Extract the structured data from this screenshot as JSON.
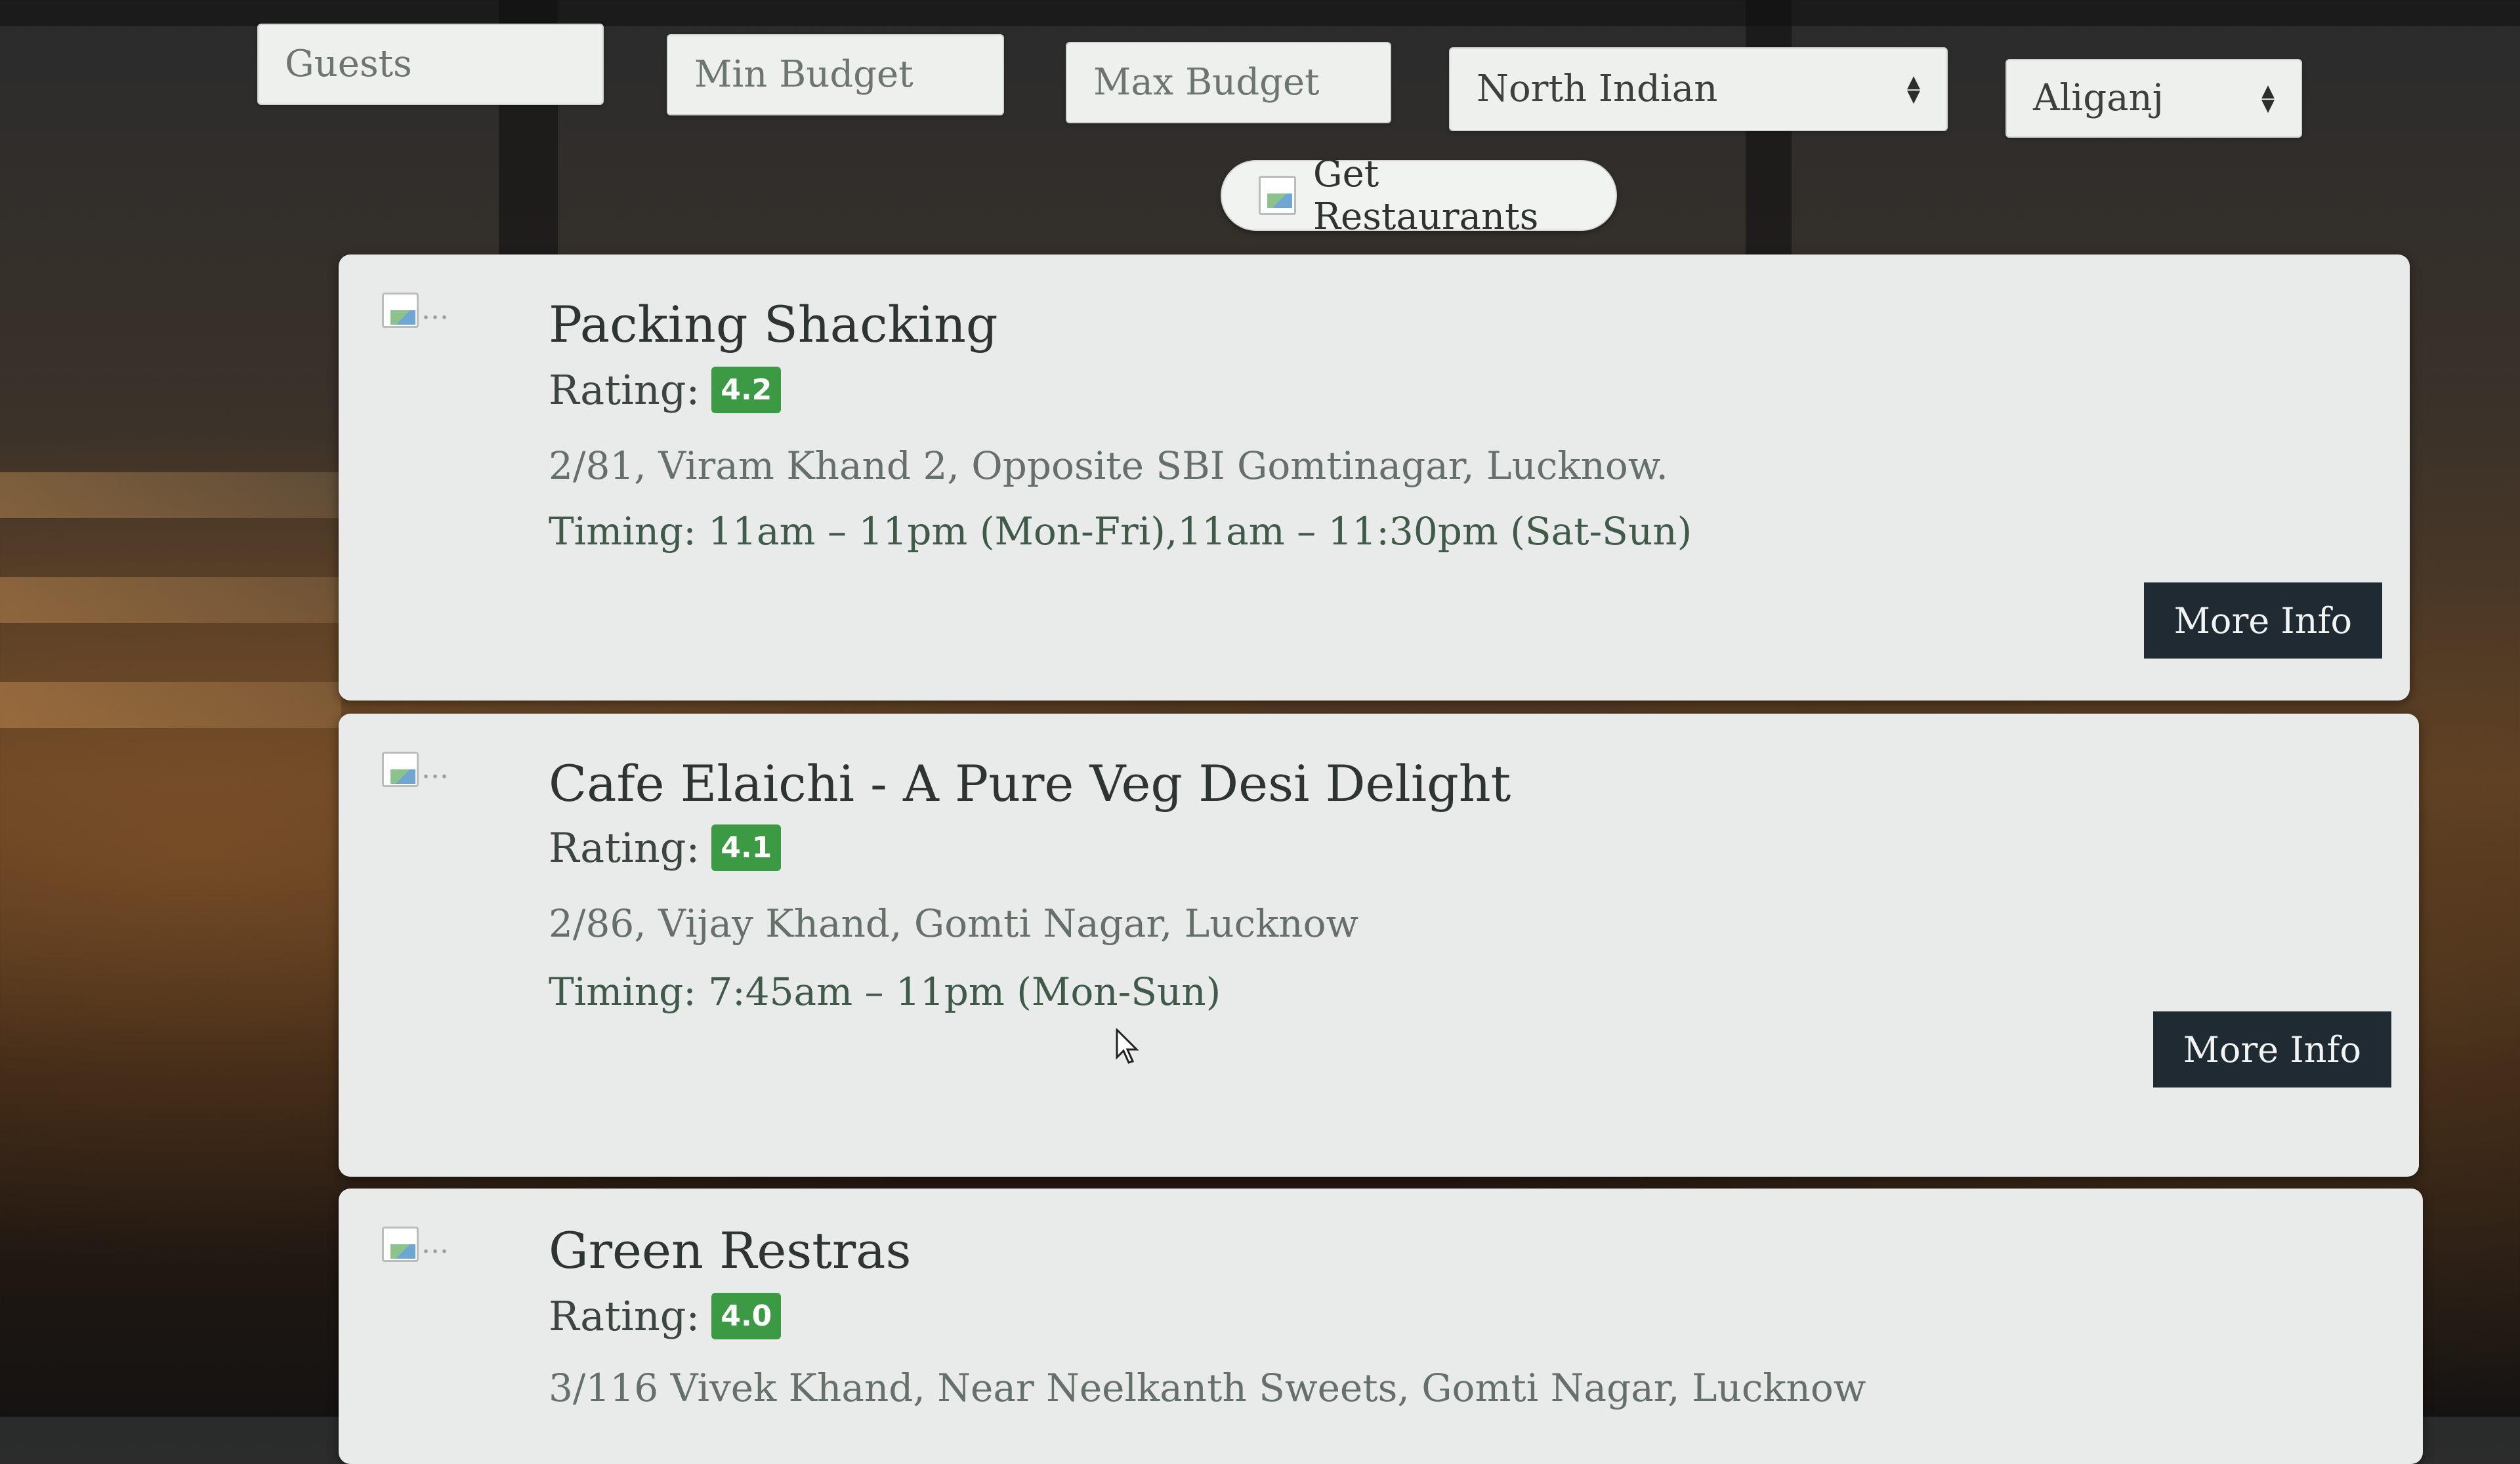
{
  "filters": {
    "guests_placeholder": "Guests",
    "min_budget_placeholder": "Min Budget",
    "max_budget_placeholder": "Max Budget",
    "cuisine_selected": "North Indian",
    "locality_selected": "Aliganj"
  },
  "actions": {
    "get_restaurants_label": "Get Restaurants"
  },
  "restaurants": [
    {
      "image_alt": "...",
      "name": "Packing Shacking",
      "rating_label": "Rating:",
      "rating": "4.2",
      "address": "2/81, Viram Khand 2, Opposite SBI Gomtinagar, Lucknow.",
      "timing": "Timing: 11am – 11pm (Mon-Fri),11am – 11:30pm (Sat-Sun)",
      "more_info_label": "More Info"
    },
    {
      "image_alt": "...",
      "name": "Cafe Elaichi - A Pure Veg Desi Delight",
      "rating_label": "Rating:",
      "rating": "4.1",
      "address": "2/86, Vijay Khand, Gomti Nagar, Lucknow",
      "timing": "Timing: 7:45am – 11pm (Mon-Sun)",
      "more_info_label": "More Info"
    },
    {
      "image_alt": "...",
      "name": "Green Restras",
      "rating_label": "Rating:",
      "rating": "4.0",
      "address": "3/116 Vivek Khand, Near Neelkanth Sweets, Gomti Nagar, Lucknow"
    }
  ],
  "colors": {
    "rating_badge": "#3c9a45",
    "more_info_button": "#1f2a33",
    "card_background": "#e9ebea"
  },
  "icons": {
    "select_arrows": "sort-arrows-icon",
    "broken_image": "broken-image-icon",
    "cursor": "mouse-pointer-icon"
  }
}
